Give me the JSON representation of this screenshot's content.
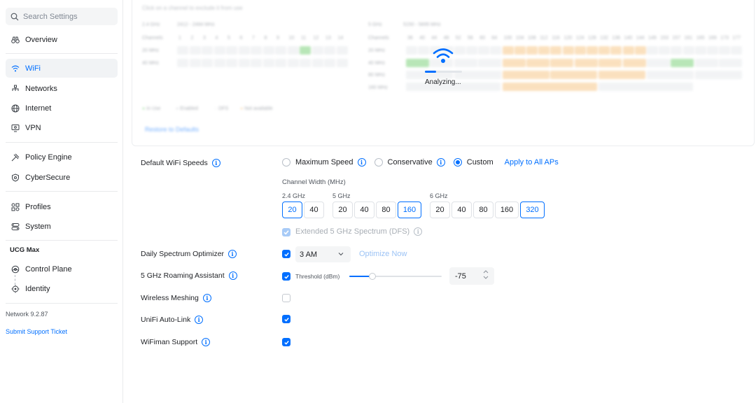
{
  "sidebar": {
    "search_placeholder": "Search Settings",
    "items": [
      {
        "label": "Overview",
        "icon": "binoculars-icon"
      },
      {
        "label": "WiFi",
        "icon": "wifi-icon",
        "active": true
      },
      {
        "label": "Networks",
        "icon": "network-topology-icon"
      },
      {
        "label": "Internet",
        "icon": "globe-icon"
      },
      {
        "label": "VPN",
        "icon": "vpn-monitor-icon"
      },
      {
        "label": "Policy Engine",
        "icon": "policy-engine-icon"
      },
      {
        "label": "CyberSecure",
        "icon": "shield-icon"
      },
      {
        "label": "Profiles",
        "icon": "profiles-icon"
      },
      {
        "label": "System",
        "icon": "system-icon"
      }
    ],
    "device_section_title": "UCG Max",
    "device_items": [
      {
        "label": "Control Plane",
        "icon": "control-plane-icon"
      },
      {
        "label": "Identity",
        "icon": "identity-icon"
      }
    ],
    "version": "Network 9.2.87",
    "support_link": "Submit Support Ticket"
  },
  "channel_panel": {
    "hint": "Click on a channel to exclude it from use",
    "band_24": {
      "name": "2.4 GHz",
      "range": "2412 - 2484 MHz"
    },
    "band_5": {
      "name": "5 GHz",
      "range": "5150 - 5895 MHz"
    },
    "channels_label": "Channels",
    "channels_24": [
      "1",
      "2",
      "3",
      "4",
      "5",
      "6",
      "7",
      "8",
      "9",
      "10",
      "11",
      "12",
      "13",
      "14"
    ],
    "channels_5": [
      "36",
      "40",
      "44",
      "48",
      "52",
      "56",
      "60",
      "64",
      "100",
      "104",
      "108",
      "112",
      "116",
      "120",
      "124",
      "128",
      "132",
      "136",
      "140",
      "144",
      "149",
      "153",
      "157",
      "161",
      "165",
      "169",
      "173",
      "177"
    ],
    "row_labels_24": [
      "20 MHz",
      "40 MHz"
    ],
    "row_labels_5": [
      "20 MHz",
      "40 MHz",
      "80 MHz",
      "160 MHz"
    ],
    "legend": [
      "In Use",
      "Enabled",
      "DFS",
      "Not available"
    ],
    "restore_link": "Restore to Defaults",
    "analyzing": {
      "text": "Analyzing...",
      "progress": 0.3
    }
  },
  "settings": {
    "default_speeds": {
      "label": "Default WiFi Speeds",
      "options": [
        "Maximum Speed",
        "Conservative",
        "Custom"
      ],
      "selected": "Custom",
      "apply_link": "Apply to All APs"
    },
    "channel_width": {
      "title": "Channel Width (MHz)",
      "bands": [
        {
          "name": "2.4 GHz",
          "options": [
            "20",
            "40"
          ],
          "selected": "20"
        },
        {
          "name": "5 GHz",
          "options": [
            "20",
            "40",
            "80",
            "160"
          ],
          "selected": "160"
        },
        {
          "name": "6 GHz",
          "options": [
            "20",
            "40",
            "80",
            "160",
            "320"
          ],
          "selected": "320"
        }
      ]
    },
    "extended_dfs": {
      "label": "Extended 5 GHz Spectrum (DFS)",
      "checked": true,
      "disabled": true
    },
    "spectrum_optimizer": {
      "label": "Daily Spectrum Optimizer",
      "checked": true,
      "time": "3 AM",
      "action": "Optimize Now"
    },
    "roaming_assistant": {
      "label": "5 GHz Roaming Assistant",
      "checked": true,
      "threshold_label": "Threshold (dBm)",
      "value": "-75",
      "slider_fraction": 0.25
    },
    "wireless_meshing": {
      "label": "Wireless Meshing",
      "checked": false
    },
    "auto_link": {
      "label": "UniFi Auto-Link",
      "checked": true
    },
    "wifiman": {
      "label": "WiFiman Support",
      "checked": true
    }
  },
  "colors": {
    "accent": "#006fff",
    "in_use": "#7fd27e",
    "dfs": "#f7c88a"
  }
}
